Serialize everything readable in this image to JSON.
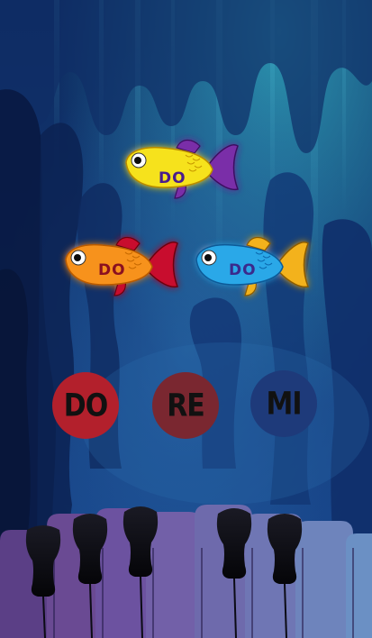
{
  "scene": {
    "title": "",
    "colors": {
      "water_top": "#0d2a5e",
      "water_bottom": "#1a3f86",
      "glow": "#2f8fb0"
    }
  },
  "fish": [
    {
      "id": "yellow",
      "label": "DO",
      "body_color": "#f6e21a",
      "fin_color": "#7a2fa8",
      "label_color": "#4a1c8c"
    },
    {
      "id": "orange",
      "label": "DO",
      "body_color": "#f7921c",
      "fin_color": "#c8102e",
      "label_color": "#8a1020"
    },
    {
      "id": "blue",
      "label": "DO",
      "body_color": "#2aa8e8",
      "fin_color": "#f3b21c",
      "label_color": "#3a2a8c"
    }
  ],
  "note_buttons": [
    {
      "label": "DO",
      "color": "#b3202c"
    },
    {
      "label": "RE",
      "color": "#7a2730"
    },
    {
      "label": "MI",
      "color": "#1e3a7a"
    }
  ],
  "piano": {
    "white_key_colors": [
      "#5b3f86",
      "#6a4a93",
      "#6c52a0",
      "#7260a8",
      "#6e6aac",
      "#6f76b4",
      "#6e84bc",
      "#6b90c4"
    ],
    "black_key_color": "#0b0b14"
  }
}
